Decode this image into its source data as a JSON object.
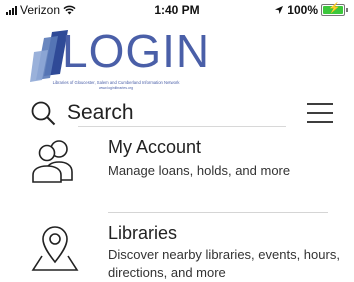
{
  "status": {
    "carrier": "Verizon",
    "time": "1:40 PM",
    "battery": "100%",
    "battery_level": 1.0
  },
  "logo": {
    "wordmark": "LOGIN",
    "subtitle": "Libraries of Gloucester, Salem and Cumberland Information Network",
    "url": "www.loginlibraries.org"
  },
  "search": {
    "label": "Search"
  },
  "menu": [
    {
      "title": "My Account",
      "description": "Manage loans, holds, and more"
    },
    {
      "title": "Libraries",
      "description": "Discover nearby libraries, events, hours, directions, and more"
    }
  ],
  "colors": {
    "logo_blue": "#4a5fa8",
    "battery_green": "#3cc73c"
  }
}
